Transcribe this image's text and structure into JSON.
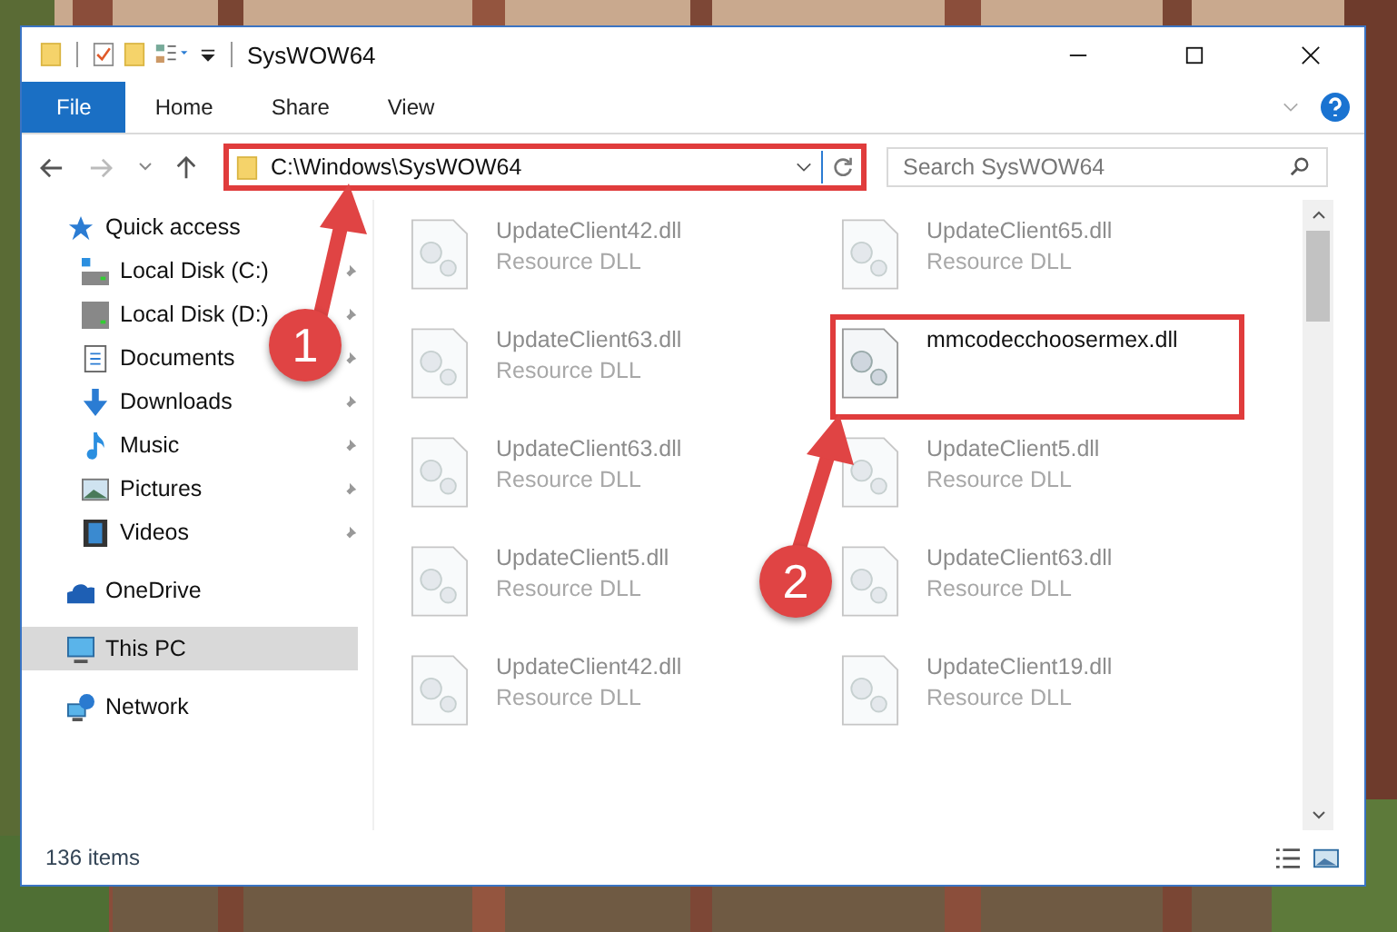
{
  "window": {
    "title": "SysWOW64"
  },
  "ribbon_tabs": [
    {
      "label": "File",
      "selected": true
    },
    {
      "label": "Home",
      "selected": false
    },
    {
      "label": "Share",
      "selected": false
    },
    {
      "label": "View",
      "selected": false
    }
  ],
  "address": {
    "value": "C:\\Windows\\SysWOW64",
    "highlighted": true
  },
  "search": {
    "placeholder": "Search SysWOW64"
  },
  "sidebar": {
    "items": [
      {
        "label": "Quick access",
        "kind": "star",
        "selected": false,
        "children": [
          {
            "label": "Local Disk (C:)",
            "kind": "drive",
            "pinned": true,
            "selected": false
          },
          {
            "label": "Local Disk (D:)",
            "kind": "drive",
            "pinned": true,
            "selected": false
          },
          {
            "label": "Documents",
            "kind": "document",
            "pinned": true,
            "selected": false
          },
          {
            "label": "Downloads",
            "kind": "download",
            "pinned": true,
            "selected": false
          },
          {
            "label": "Music",
            "kind": "music",
            "pinned": true,
            "selected": false
          },
          {
            "label": "Pictures",
            "kind": "pictures",
            "pinned": true,
            "selected": false
          },
          {
            "label": "Videos",
            "kind": "videos",
            "pinned": true,
            "selected": false
          }
        ]
      },
      {
        "label": "OneDrive",
        "kind": "cloud",
        "selected": false
      },
      {
        "label": "This PC",
        "kind": "monitor",
        "selected": true
      },
      {
        "label": "Network",
        "kind": "network",
        "selected": false
      }
    ]
  },
  "files": [
    {
      "name": "UpdateClient42.dll",
      "type": "Resource DLL",
      "faded": true,
      "highlighted": false
    },
    {
      "name": "UpdateClient65.dll",
      "type": "Resource DLL",
      "faded": true,
      "highlighted": false
    },
    {
      "name": "UpdateClient63.dll",
      "type": "Resource DLL",
      "faded": true,
      "highlighted": false
    },
    {
      "name": "mmcodecchoosermex.dll",
      "faded": false,
      "highlighted": true
    },
    {
      "name": "UpdateClient63.dll",
      "type": "Resource DLL",
      "faded": true,
      "highlighted": false
    },
    {
      "name": "UpdateClient5.dll",
      "type": "Resource DLL",
      "faded": true,
      "highlighted": false
    },
    {
      "name": "UpdateClient5.dll",
      "type": "Resource DLL",
      "faded": true,
      "highlighted": false
    },
    {
      "name": "UpdateClient63.dll",
      "type": "Resource DLL",
      "faded": true,
      "highlighted": false
    },
    {
      "name": "UpdateClient42.dll",
      "type": "Resource DLL",
      "faded": true,
      "highlighted": false
    },
    {
      "name": "UpdateClient19.dll",
      "type": "Resource DLL",
      "faded": true,
      "highlighted": false
    }
  ],
  "status_bar": {
    "count": "136 items"
  },
  "callouts": [
    {
      "label": "1"
    },
    {
      "label": "2"
    }
  ]
}
